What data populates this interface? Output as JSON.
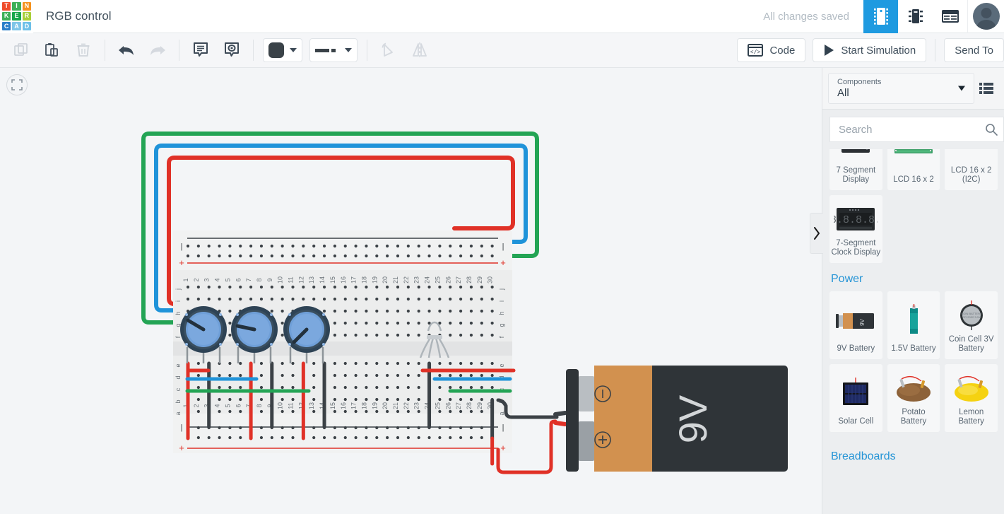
{
  "app": {
    "logo_letters": [
      {
        "ch": "T",
        "color": "#ef4b2a"
      },
      {
        "ch": "I",
        "color": "#3eaf56"
      },
      {
        "ch": "N",
        "color": "#f5921e"
      },
      {
        "ch": "K",
        "color": "#3eaf56"
      },
      {
        "ch": "E",
        "color": "#17a74a"
      },
      {
        "ch": "R",
        "color": "#a8cf38"
      },
      {
        "ch": "C",
        "color": "#2a7fc9"
      },
      {
        "ch": "A",
        "color": "#7ec5e8"
      },
      {
        "ch": "D",
        "color": "#6ec0e8"
      }
    ],
    "document_title": "RGB control",
    "save_status": "All changes saved",
    "view_buttons": [
      {
        "name": "breadboard-view",
        "icon": "breadboard-icon",
        "active": true
      },
      {
        "name": "schematic-view",
        "icon": "chip-icon",
        "active": false
      },
      {
        "name": "list-view",
        "icon": "component-list-icon",
        "active": false
      }
    ],
    "avatar_label": "user-avatar"
  },
  "toolbar": {
    "buttons": [
      {
        "name": "copy-button",
        "icon": "copy-icon",
        "disabled": true
      },
      {
        "name": "paste-button",
        "icon": "clipboard-icon",
        "disabled": false
      },
      {
        "name": "delete-button",
        "icon": "trash-icon",
        "disabled": true
      },
      {
        "name": "undo-button",
        "icon": "undo-arrow-icon",
        "disabled": false
      },
      {
        "name": "redo-button",
        "icon": "redo-arrow-icon",
        "disabled": true
      },
      {
        "name": "note-button",
        "icon": "note-icon",
        "disabled": false
      },
      {
        "name": "highlight-button",
        "icon": "highlight-icon",
        "disabled": false
      }
    ],
    "color_swatch": "#3a4248",
    "line_style": "dashed",
    "rotate_label": "rotate-button",
    "mirror_label": "mirror-button",
    "code_label": "Code",
    "simulation_label": "Start Simulation",
    "send_to_label": "Send To"
  },
  "canvas": {
    "fit_button": "fit-to-screen-button",
    "breadboard": {
      "columns": [
        1,
        2,
        3,
        4,
        5,
        6,
        7,
        8,
        9,
        10,
        11,
        12,
        13,
        14,
        15,
        16,
        17,
        18,
        19,
        20,
        21,
        22,
        23,
        24,
        25,
        26,
        27,
        28,
        29,
        30
      ],
      "top_rows": [
        "j",
        "i",
        "h",
        "g",
        "f"
      ],
      "bottom_rows": [
        "e",
        "d",
        "c",
        "b",
        "a"
      ],
      "rail_minus": "—",
      "rail_plus": "+"
    },
    "components": [
      {
        "name": "potentiometer-1",
        "type": "potentiometer",
        "color": "#6f9fd8"
      },
      {
        "name": "potentiometer-2",
        "type": "potentiometer",
        "color": "#6f9fd8"
      },
      {
        "name": "potentiometer-3",
        "type": "potentiometer",
        "color": "#6f9fd8"
      },
      {
        "name": "rgb-led",
        "type": "rgb-led"
      },
      {
        "name": "battery-9v",
        "type": "battery",
        "label": "9V",
        "terminal_minus": "−",
        "terminal_plus": "+"
      }
    ],
    "wire_colors": {
      "red": "#e03127",
      "blue": "#1f93d9",
      "green": "#23a455",
      "black": "#3b4146"
    }
  },
  "panel": {
    "dropdown_label": "Components",
    "dropdown_value": "All",
    "list_view_icon": "list-view-icon",
    "search_placeholder": "Search",
    "search_value": "",
    "collapse_handle": "panel-collapse-handle",
    "groups": [
      {
        "title": "",
        "items": [
          {
            "label": "7 Segment Display",
            "icon": "seven-segment-display-icon"
          },
          {
            "label": "LCD 16 x 2",
            "icon": "lcd-16x2-icon"
          },
          {
            "label": "LCD 16 x 2 (I2C)",
            "icon": "lcd-16x2-i2c-icon"
          },
          {
            "label": "7-Segment Clock Display",
            "icon": "seven-segment-clock-icon"
          }
        ]
      },
      {
        "title": "Power",
        "items": [
          {
            "label": "9V Battery",
            "icon": "9v-battery-icon"
          },
          {
            "label": "1.5V Battery",
            "icon": "aa-battery-icon"
          },
          {
            "label": "Coin Cell 3V Battery",
            "icon": "coin-cell-icon"
          },
          {
            "label": "Solar Cell",
            "icon": "solar-cell-icon"
          },
          {
            "label": "Potato Battery",
            "icon": "potato-battery-icon"
          },
          {
            "label": "Lemon Battery",
            "icon": "lemon-battery-icon"
          }
        ]
      },
      {
        "title": "Breadboards",
        "items": []
      }
    ]
  }
}
